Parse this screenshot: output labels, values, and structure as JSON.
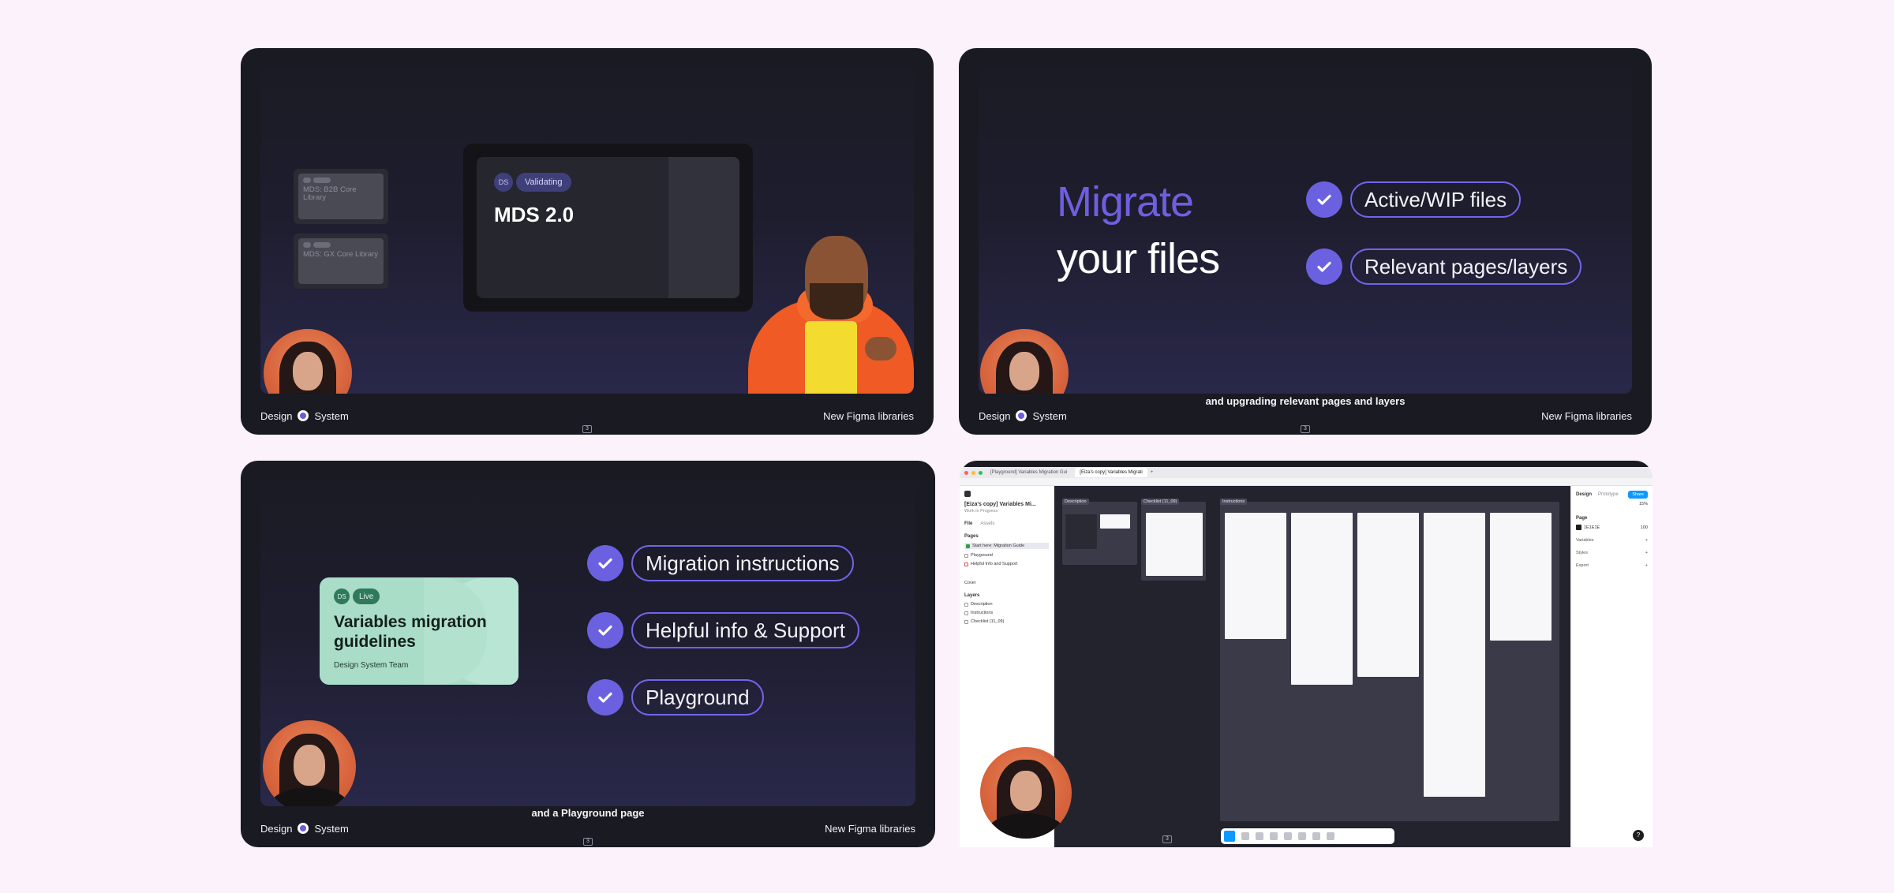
{
  "footer": {
    "brand_left": "Design",
    "brand_right": "System",
    "deck_title": "New Figma libraries",
    "slide_number": "3"
  },
  "slide1": {
    "libraries": [
      {
        "name": "MDS: B2B Core Library"
      },
      {
        "name": "MDS: GX Core Library"
      }
    ],
    "card": {
      "ds_tag": "DS",
      "status": "Validating",
      "title": "MDS 2.0"
    }
  },
  "slide2": {
    "title_accent": "Migrate",
    "title_rest": "your files",
    "checks": [
      "Active/WIP files",
      "Relevant pages/layers"
    ],
    "caption": "and upgrading relevant pages and layers"
  },
  "slide3": {
    "card": {
      "ds_tag": "DS",
      "status": "Live",
      "title": "Variables migration guidelines",
      "team": "Design System Team"
    },
    "checks": [
      "Migration instructions",
      "Helpful info & Support",
      "Playground"
    ],
    "caption": "and a Playground page"
  },
  "slide4": {
    "tabs": [
      "[Playground] Variables Migration Gui",
      "[Eiza's copy] Variables Migrati"
    ],
    "file_name": "[Eiza's copy] Variables Mi...",
    "file_status": "Work in Progress",
    "left_tabs": [
      "File",
      "Assets"
    ],
    "pages_label": "Pages",
    "pages": [
      "Start here: Migration Guide",
      "Playground",
      "Helpful Info and Support",
      "Cover"
    ],
    "layers_label": "Layers",
    "layers": [
      "Description",
      "Instructions",
      "Checklist (11_09)"
    ],
    "canvas_sections": [
      "Description",
      "Checklist (11_09)",
      "Instructions"
    ],
    "right_tabs": [
      "Design",
      "Prototype"
    ],
    "zoom": "15%",
    "share_label": "Share",
    "page_label": "Page",
    "page_color": "1E1E1E",
    "page_opacity": "100",
    "panel_rows": [
      "Variables",
      "Styles",
      "Export"
    ],
    "help_label": "?"
  }
}
